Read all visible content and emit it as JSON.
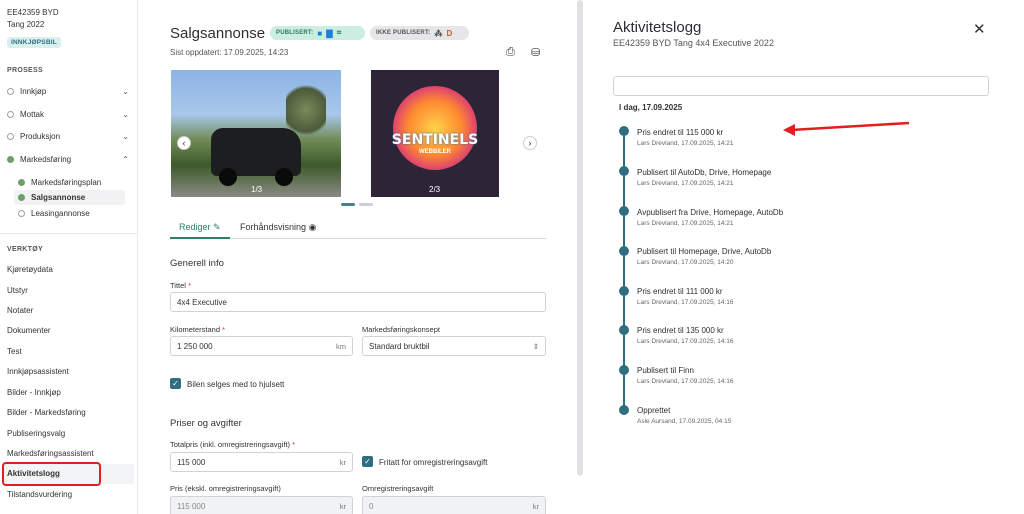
{
  "vehicle": {
    "id": "EE42359 BYD",
    "name": "Tang 2022",
    "badge": "INNKJØPSBIL"
  },
  "sidebar": {
    "process_heading": "PROSESS",
    "process_items": [
      {
        "label": "Innkjøp"
      },
      {
        "label": "Mottak"
      },
      {
        "label": "Produksjon"
      },
      {
        "label": "Markedsføring"
      }
    ],
    "sub_items": [
      {
        "label": "Markedsføringsplan"
      },
      {
        "label": "Salgsannonse"
      },
      {
        "label": "Leasingannonse"
      }
    ],
    "tools_heading": "VERKTØY",
    "tools": [
      {
        "label": "Kjøretøydata"
      },
      {
        "label": "Utstyr"
      },
      {
        "label": "Notater"
      },
      {
        "label": "Dokumenter"
      },
      {
        "label": "Test"
      },
      {
        "label": "Innkjøpsassistent"
      },
      {
        "label": "Bilder - Innkjøp"
      },
      {
        "label": "Bilder - Markedsføring"
      },
      {
        "label": "Publiseringsvalg"
      },
      {
        "label": "Markedsføringsassistent"
      },
      {
        "label": "Aktivitetslogg"
      },
      {
        "label": "Tilstandsvurdering"
      }
    ]
  },
  "main": {
    "title": "Salgsannonse",
    "pill_published": "PUBLISERT:",
    "pill_unpublished": "IKKE PUBLISERT:",
    "updated": "Sist oppdatert: 17.09.2025, 14:23",
    "image1_counter": "1/3",
    "image2_counter": "2/3",
    "image2_brand": "SENTINELS",
    "image2_sub": "WEBBILER",
    "tabs": {
      "edit": "Rediger",
      "preview": "Forhåndsvisning"
    },
    "general_heading": "Generell info",
    "title_label": "Tittel",
    "title_value": "4x4 Executive",
    "km_label": "Kilometerstand",
    "km_value": "1 250 000",
    "km_unit": "km",
    "concept_label": "Markedsføringskonsept",
    "concept_value": "Standard bruktbil",
    "wheels_label": "Bilen selges med to hjulsett",
    "prices_heading": "Priser og avgifter",
    "total_label": "Totalpris (inkl. omregistreringsavgift)",
    "total_value": "115 000",
    "currency": "kr",
    "exempt_label": "Fritatt for omregistreringsavgift",
    "price_ex_label": "Pris (ekskl. omregistreringsavgift)",
    "price_ex_value": "115 000",
    "reg_fee_label": "Omregistreringsavgift",
    "reg_fee_value": "0"
  },
  "log": {
    "title": "Aktivitetslogg",
    "subtitle": "EE42359 BYD Tang 4x4 Executive 2022",
    "day": "I dag, 17.09.2025",
    "events": [
      {
        "title": "Pris endret til 115 000 kr",
        "meta": "Lars Drevland, 17.09.2025, 14:21"
      },
      {
        "title": "Publisert til AutoDb, Drive, Homepage",
        "meta": "Lars Drevland, 17.09.2025, 14:21"
      },
      {
        "title": "Avpublisert fra Drive, Homepage, AutoDb",
        "meta": "Lars Drevland, 17.09.2025, 14:21"
      },
      {
        "title": "Publisert til Homepage, Drive, AutoDb",
        "meta": "Lars Drevland, 17.09.2025, 14:20"
      },
      {
        "title": "Pris endret til 111 000 kr",
        "meta": "Lars Drevland, 17.09.2025, 14:16"
      },
      {
        "title": "Pris endret til 135 000 kr",
        "meta": "Lars Drevland, 17.09.2025, 14:16"
      },
      {
        "title": "Publisert til Finn",
        "meta": "Lars Drevland, 17.09.2025, 14:16"
      },
      {
        "title": "Opprettet",
        "meta": "Asle Aursand, 17.09.2025, 04:15"
      }
    ]
  },
  "colors": {
    "accent": "#2f6e7f",
    "highlight": "#e02020"
  }
}
